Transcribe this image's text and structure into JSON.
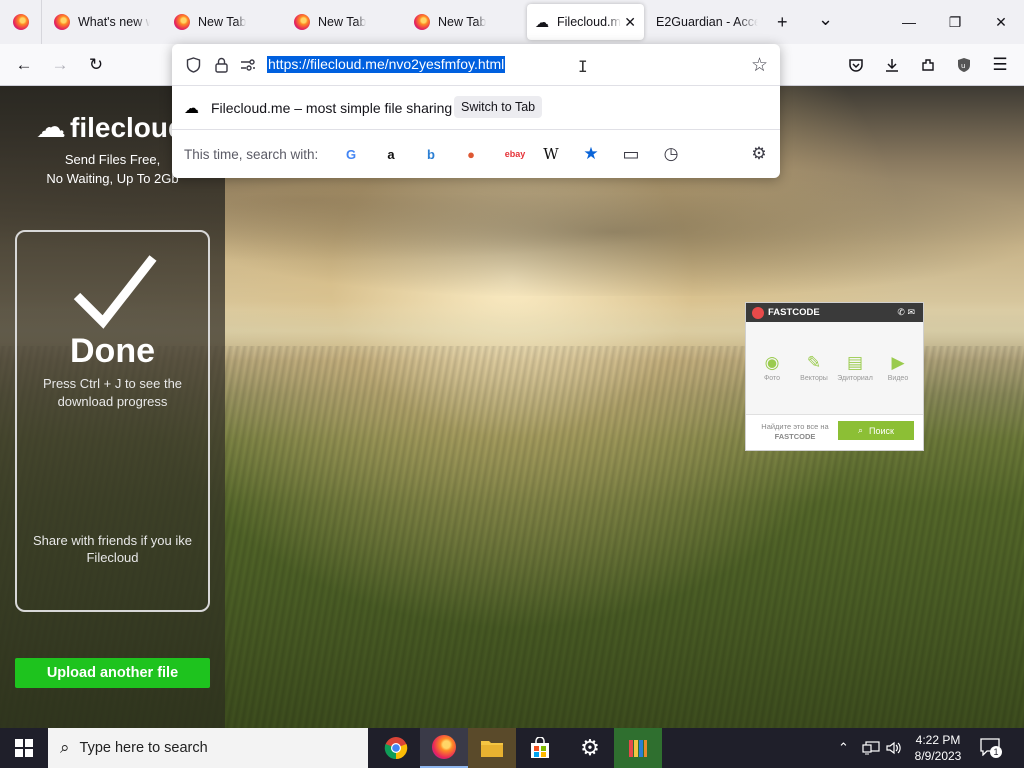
{
  "browser": {
    "tabs": [
      {
        "label": "What's new w"
      },
      {
        "label": "New Tab"
      },
      {
        "label": "New Tab"
      },
      {
        "label": "New Tab"
      },
      {
        "label": "Filecloud.m"
      },
      {
        "label": "E2Guardian - Acce"
      }
    ],
    "new_tab_symbol": "+",
    "list_tabs_symbol": "⌄",
    "window_controls": {
      "minimize": "—",
      "maximize": "❐",
      "close": "✕"
    }
  },
  "url_bar": {
    "url": "https://filecloud.me/nvo2yesfmfoy.html",
    "suggestion_title": "Filecloud.me – most simple file sharing",
    "switch_to_tab": "Switch to Tab",
    "search_with_label": "This time, search with:",
    "engines": [
      {
        "name": "google-icon",
        "glyph": "G",
        "color": "#4285f4"
      },
      {
        "name": "amazon-icon",
        "glyph": "a",
        "color": "#111111"
      },
      {
        "name": "bing-icon",
        "glyph": "b",
        "color": "#2b7fd4"
      },
      {
        "name": "duckduckgo-icon",
        "glyph": "●",
        "color": "#de5833"
      },
      {
        "name": "ebay-icon",
        "glyph": "ebay",
        "color": "#e53238"
      },
      {
        "name": "wikipedia-icon",
        "glyph": "W",
        "color": "#111111"
      },
      {
        "name": "bookmarks-icon",
        "glyph": "★",
        "color": "#0a64d8"
      },
      {
        "name": "tabs-icon",
        "glyph": "▭",
        "color": "#3a3944"
      },
      {
        "name": "history-icon",
        "glyph": "◷",
        "color": "#3a3944"
      }
    ]
  },
  "page": {
    "logo_text": "filecloud",
    "tagline_1": "Send Files Free,",
    "tagline_2": "No Waiting, Up To 2Gb",
    "done_title": "Done",
    "done_text_1": "Press Ctrl + J to see the",
    "done_text_2": "download progress",
    "share_text_1": "Share with friends if you ike",
    "share_text_2": "Filecloud",
    "upload_button": "Upload another file",
    "upload_button_color": "#1ec31e"
  },
  "fastcode": {
    "title": "FASTCODE",
    "items": [
      {
        "label": "Фото",
        "glyph": "◉"
      },
      {
        "label": "Векторы",
        "glyph": "✎"
      },
      {
        "label": "Эдиториал",
        "glyph": "▤"
      },
      {
        "label": "Видео",
        "glyph": "▶"
      }
    ],
    "footer_text_1": "Найдите это все на",
    "footer_text_2": "FASTCODE",
    "search_button": "Поиск"
  },
  "taskbar": {
    "search_placeholder": "Type here to search",
    "time": "4:22 PM",
    "date": "8/9/2023",
    "notification_count": "1"
  }
}
